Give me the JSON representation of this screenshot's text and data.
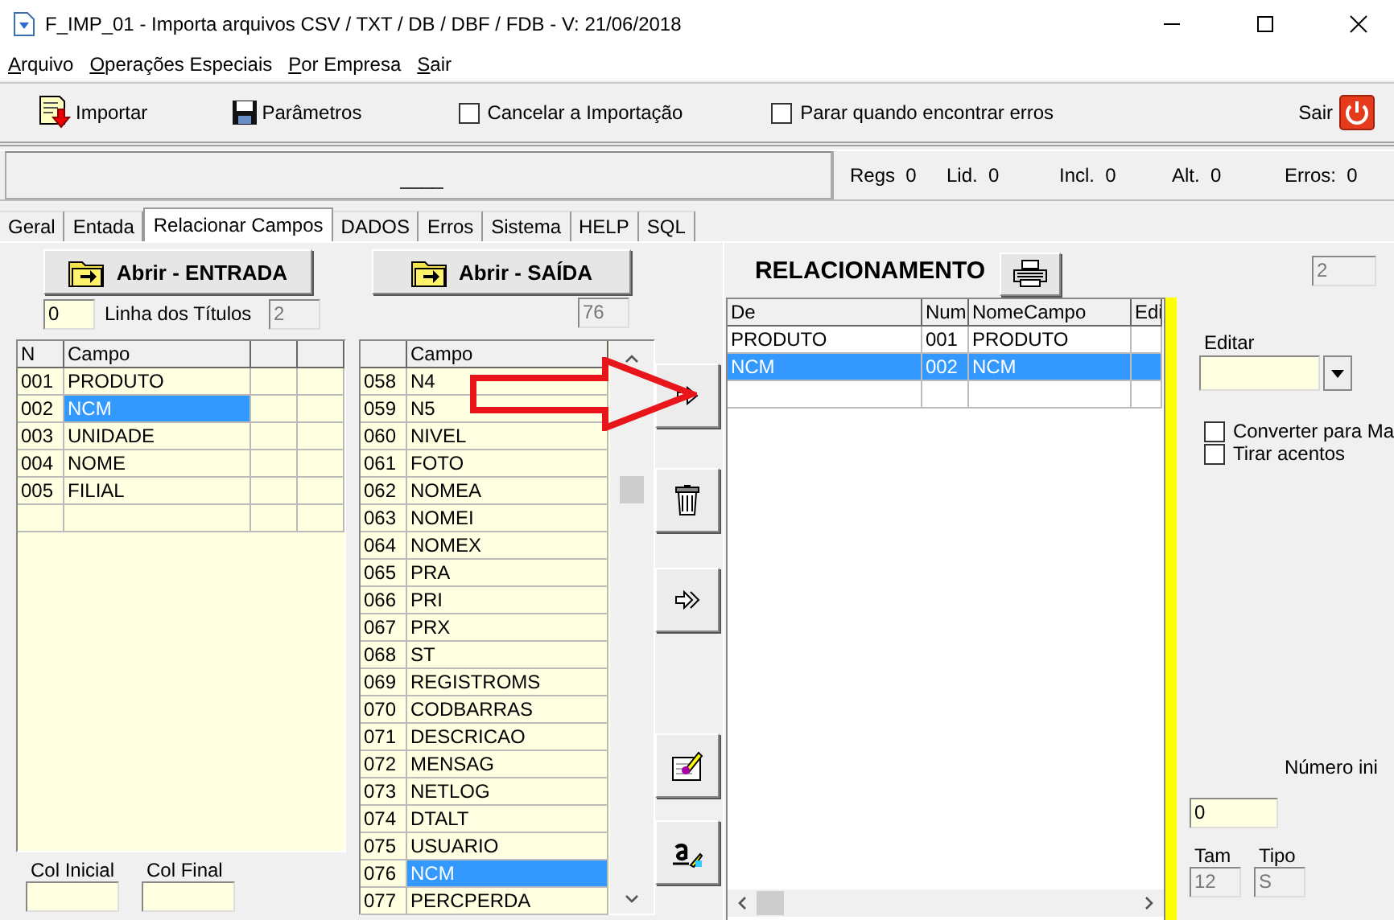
{
  "window": {
    "title": "F_IMP_01 - Importa arquivos CSV / TXT / DB / DBF / FDB - V: 21/06/2018"
  },
  "menu": [
    "Arquivo",
    "Operações Especiais",
    "Por Empresa",
    "Sair"
  ],
  "toolbar": {
    "import_button": "Importar",
    "params_button": "Parâmetros",
    "checkboxes": [
      {
        "label": "Cancelar a Importação",
        "checked": false
      },
      {
        "label": "Parar quando encontrar erros",
        "checked": false
      }
    ],
    "exit_button": "Sair"
  },
  "status": {
    "progress_text": "____",
    "counters": [
      {
        "label": "Regs",
        "value": "0"
      },
      {
        "label": "Lid.",
        "value": "0"
      },
      {
        "label": "Incl.",
        "value": "0"
      },
      {
        "label": "Alt.",
        "value": "0"
      },
      {
        "label": "Erros:",
        "value": "0"
      }
    ]
  },
  "tabs": [
    {
      "label": "Geral",
      "selected": false
    },
    {
      "label": "Entada",
      "selected": false
    },
    {
      "label": "Relacionar Campos",
      "selected": true
    },
    {
      "label": "DADOS",
      "selected": false
    },
    {
      "label": "Erros",
      "selected": false
    },
    {
      "label": "Sistema",
      "selected": false
    },
    {
      "label": "HELP",
      "selected": false
    },
    {
      "label": "SQL",
      "selected": false
    }
  ],
  "entrada": {
    "open_button": "Abrir - ENTRADA",
    "title_line_value": "0",
    "title_line_label": "Linha dos Títulos",
    "count": "2",
    "columns": [
      "N",
      "Campo"
    ],
    "rows": [
      {
        "n": "001",
        "campo": "PRODUTO",
        "selected": false
      },
      {
        "n": "002",
        "campo": "NCM",
        "selected": true
      },
      {
        "n": "003",
        "campo": "UNIDADE",
        "selected": false
      },
      {
        "n": "004",
        "campo": "NOME",
        "selected": false
      },
      {
        "n": "005",
        "campo": "FILIAL",
        "selected": false
      }
    ],
    "col_inicial_label": "Col Inicial",
    "col_final_label": "Col Final"
  },
  "saida": {
    "open_button": "Abrir - SAÍDA",
    "count": "76",
    "columns": [
      "Campo"
    ],
    "rows": [
      {
        "n": "058",
        "campo": "N4",
        "selected": false
      },
      {
        "n": "059",
        "campo": "N5",
        "selected": false
      },
      {
        "n": "060",
        "campo": "NIVEL",
        "selected": false
      },
      {
        "n": "061",
        "campo": "FOTO",
        "selected": false
      },
      {
        "n": "062",
        "campo": "NOMEA",
        "selected": false
      },
      {
        "n": "063",
        "campo": "NOMEI",
        "selected": false
      },
      {
        "n": "064",
        "campo": "NOMEX",
        "selected": false
      },
      {
        "n": "065",
        "campo": "PRA",
        "selected": false
      },
      {
        "n": "066",
        "campo": "PRI",
        "selected": false
      },
      {
        "n": "067",
        "campo": "PRX",
        "selected": false
      },
      {
        "n": "068",
        "campo": "ST",
        "selected": false
      },
      {
        "n": "069",
        "campo": "REGISTROMS",
        "selected": false
      },
      {
        "n": "070",
        "campo": "CODBARRAS",
        "selected": false
      },
      {
        "n": "071",
        "campo": "DESCRICAO",
        "selected": false
      },
      {
        "n": "072",
        "campo": "MENSAG",
        "selected": false
      },
      {
        "n": "073",
        "campo": "NETLOG",
        "selected": false
      },
      {
        "n": "074",
        "campo": "DTALT",
        "selected": false
      },
      {
        "n": "075",
        "campo": "USUARIO",
        "selected": false
      },
      {
        "n": "076",
        "campo": "NCM",
        "selected": true
      },
      {
        "n": "077",
        "campo": "PERCPERDA",
        "selected": false
      }
    ]
  },
  "actions": [
    {
      "kind": "add"
    },
    {
      "kind": "delete"
    },
    {
      "kind": "add_all"
    },
    {
      "kind": "clear"
    },
    {
      "kind": "rename"
    }
  ],
  "relacionamento": {
    "title": "RELACIONAMENTO",
    "count": "2",
    "columns": [
      "De",
      "Num",
      "NomeCampo",
      "Edi"
    ],
    "rows": [
      {
        "de": "PRODUTO",
        "num": "001",
        "nome": "PRODUTO",
        "selected": false
      },
      {
        "de": "NCM",
        "num": "002",
        "nome": "NCM",
        "selected": true
      }
    ]
  },
  "options": {
    "editar_label": "Editar",
    "checkboxes": [
      {
        "label": "Converter para Ma",
        "checked": false
      },
      {
        "label": "Tirar acentos",
        "checked": false
      }
    ],
    "numero_label": "Número ini",
    "numero_value": "0",
    "tam_label": "Tam",
    "tam_value": "12",
    "tipo_label": "Tipo",
    "tipo_value": "S"
  }
}
